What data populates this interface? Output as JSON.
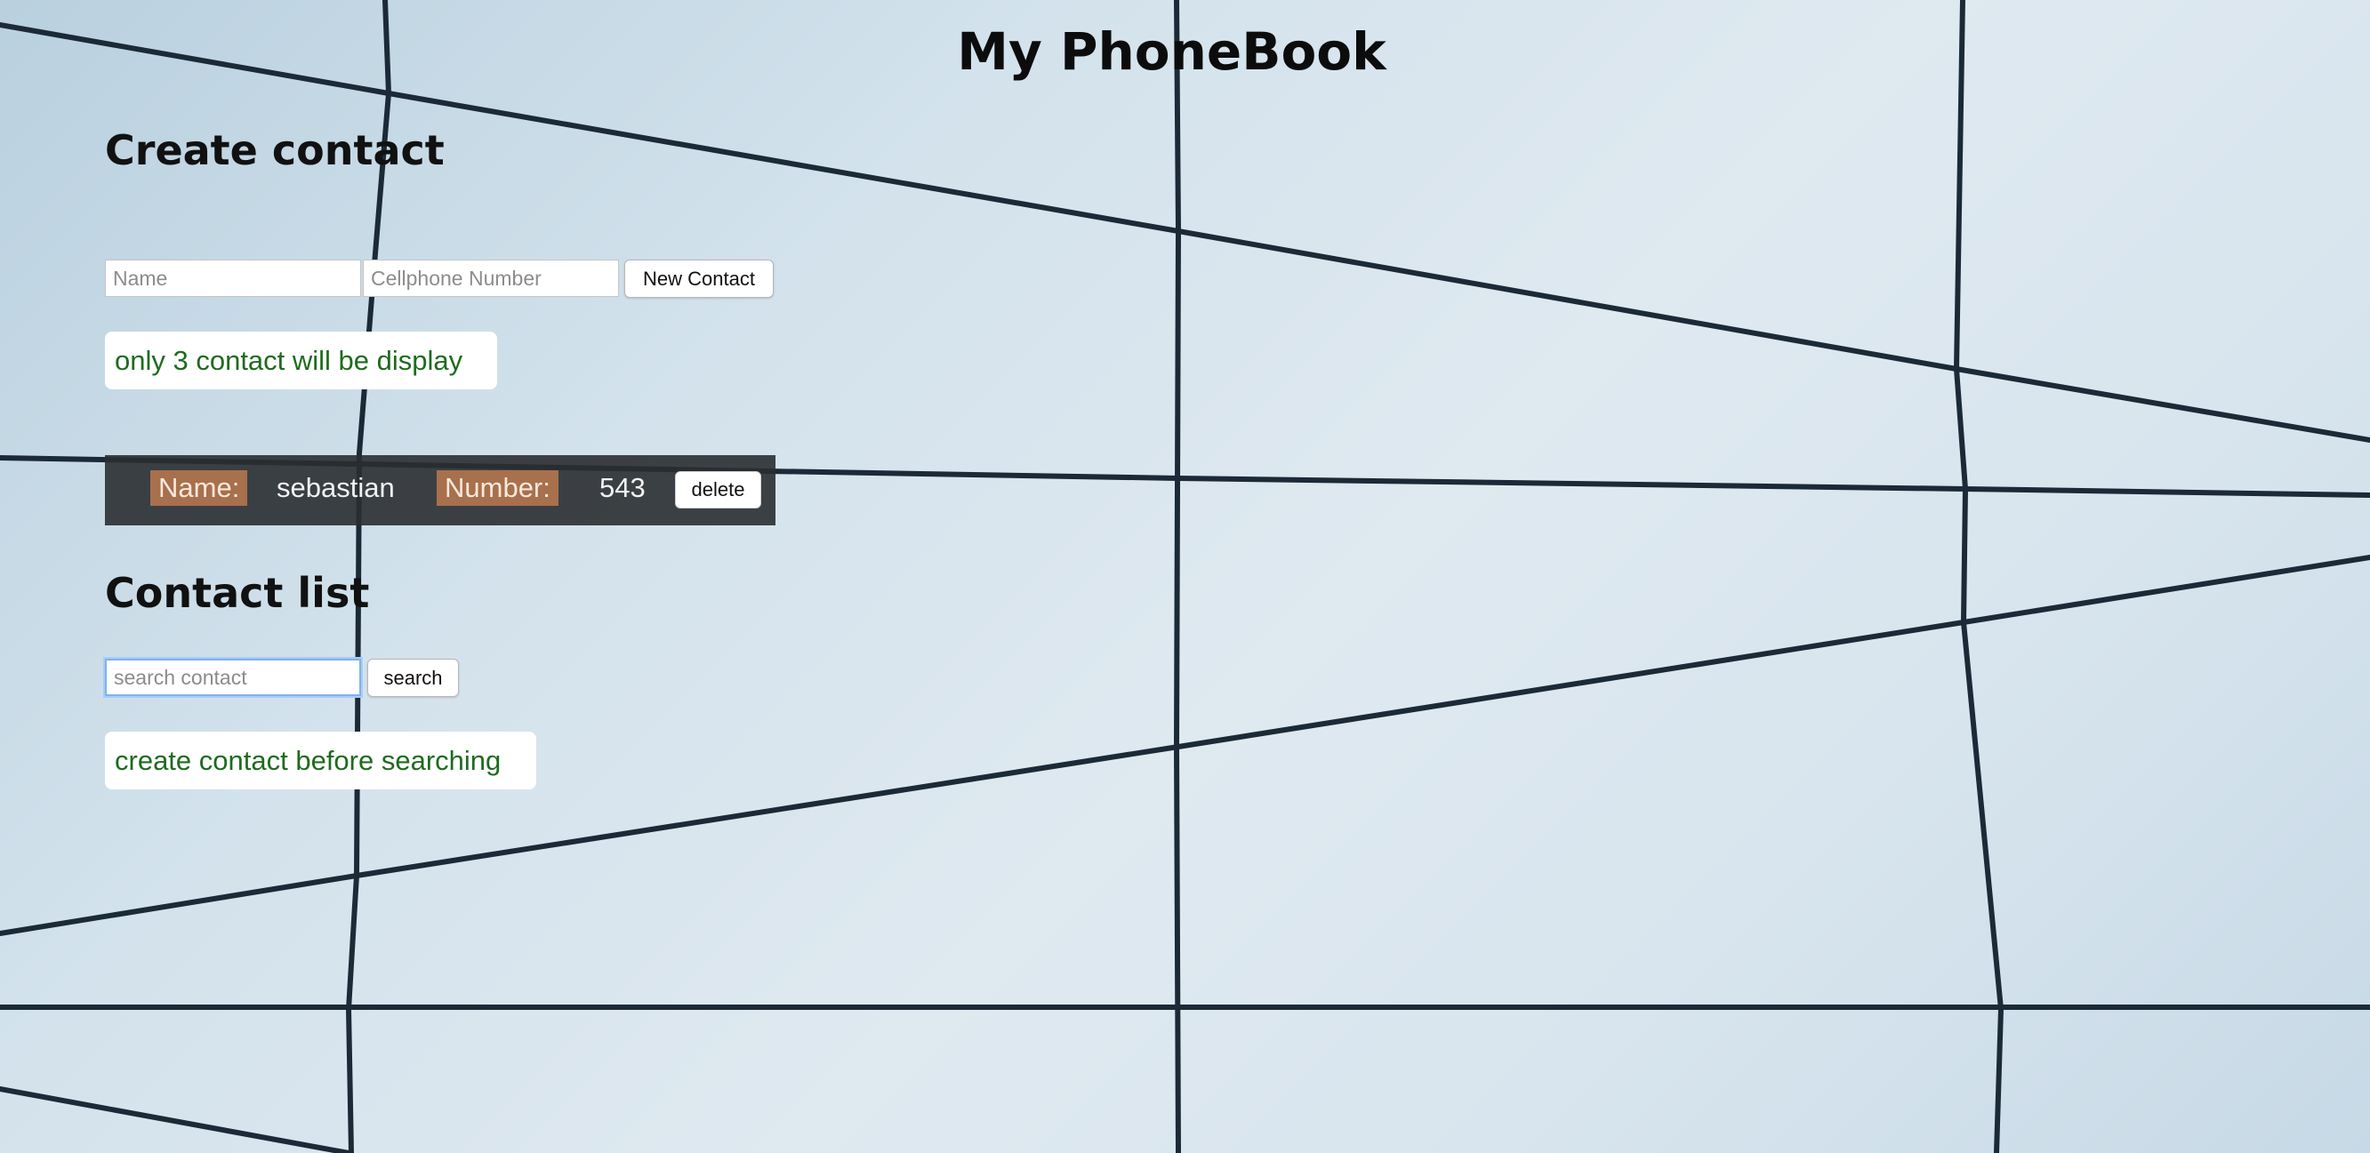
{
  "app": {
    "title": "My PhoneBook"
  },
  "create": {
    "heading": "Create contact",
    "name_placeholder": "Name",
    "name_value": "",
    "number_placeholder": "Cellphone Number",
    "number_value": "",
    "submit_label": "New Contact",
    "notice": "only 3 contact will be display"
  },
  "contacts": [
    {
      "name_label": "Name:",
      "name": "sebastian",
      "number_label": "Number:",
      "number": "543",
      "delete_label": "delete"
    }
  ],
  "list": {
    "heading": "Contact list",
    "search_placeholder": "search contact",
    "search_value": "",
    "search_label": "search",
    "notice": "create contact before searching"
  },
  "theme": {
    "notice_text_color": "#1e6b1e",
    "label_background": "#a8704c",
    "card_background": "#2a2e31",
    "focus_ring": "#7fb2ee",
    "grid_line_color": "#1b2a36"
  }
}
